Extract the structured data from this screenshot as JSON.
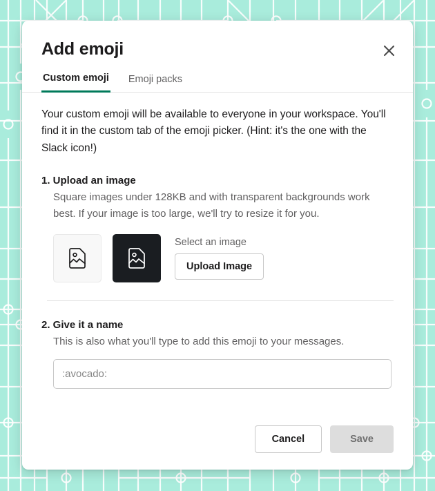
{
  "background": {
    "style": "circuit-board",
    "base_color": "#a9ecdc",
    "trace_color": "#ffffff"
  },
  "dialog": {
    "title": "Add emoji",
    "close_icon": "close-icon",
    "tabs": [
      {
        "label": "Custom emoji",
        "active": true
      },
      {
        "label": "Emoji packs",
        "active": false
      }
    ],
    "intro": "Your custom emoji will be available to everyone in your workspace. You'll find it in the custom tab of the emoji picker. (Hint: it's the one with the Slack icon!)",
    "steps": [
      {
        "title": "1. Upload an image",
        "description": "Square images under 128KB and with transparent backgrounds work best. If your image is too large, we'll try to resize it for you.",
        "previews": [
          {
            "name": "light-preview",
            "icon": "image-placeholder-icon",
            "theme": "light"
          },
          {
            "name": "dark-preview",
            "icon": "image-placeholder-icon",
            "theme": "dark"
          }
        ],
        "select_label": "Select an image",
        "upload_button": "Upload Image"
      },
      {
        "title": "2. Give it a name",
        "description": "This is also what you'll type to add this emoji to your messages.",
        "input": {
          "value": "",
          "placeholder": ":avocado:"
        }
      }
    ],
    "footer": {
      "cancel_label": "Cancel",
      "save_label": "Save",
      "save_disabled": true
    }
  },
  "colors": {
    "accent_green": "#007a5a",
    "text_primary": "#1d1c1d",
    "text_secondary": "#616061",
    "background_mint": "#a9ecdc"
  }
}
